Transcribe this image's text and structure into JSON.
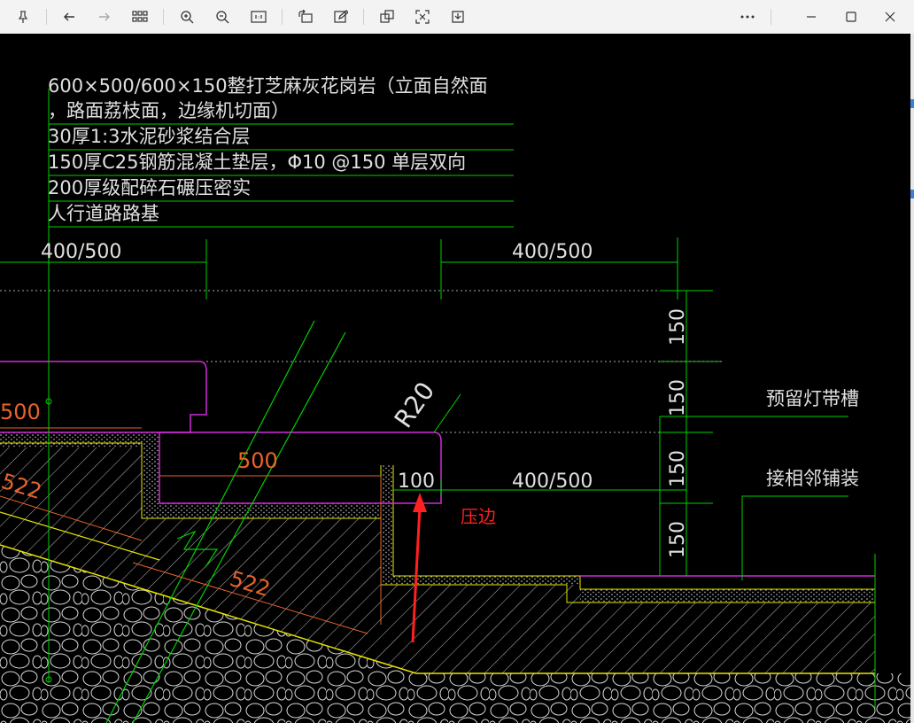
{
  "toolbar": {
    "pin_label": "Pin",
    "back_label": "Back",
    "forward_label": "Forward",
    "grid_label": "Thumbnails",
    "zoom_in_label": "Zoom in",
    "zoom_out_label": "Zoom out",
    "fit_label": "Actual size",
    "rotate_label": "Rotate",
    "edit_label": "Edit",
    "copy_label": "Copy",
    "select_label": "Select",
    "save_label": "Save",
    "more_label": "More",
    "minimize_label": "Minimize",
    "maximize_label": "Maximize",
    "close_label": "Close"
  },
  "drawing": {
    "notes": [
      "600×500/600×150整打芝麻灰花岗岩（立面自然面",
      "，路面荔枝面，边缘机切面）",
      "30厚1:3水泥砂浆结合层",
      "150厚C25钢筋混凝土垫层，Φ10 @150 单层双向",
      "200厚级配碎石碾压密实",
      "人行道路路基"
    ],
    "dims": {
      "top_left": "400/500",
      "top_right": "400/500",
      "mid_right": "400/500",
      "d100": "100",
      "r20": "R20",
      "d500_left": "500",
      "d500_mid": "500",
      "d522_left": "522",
      "d522_bottom": "522",
      "v150_1": "150",
      "v150_2": "150",
      "v150_3": "150",
      "v150_4": "150"
    },
    "labels": {
      "light_groove": "预留灯带槽",
      "adjacent": "接相邻铺装",
      "press_edge": "压边"
    },
    "colors": {
      "canvas": "#000000",
      "green": "#00d000",
      "magenta": "#d12bd8",
      "orange": "#e8632a",
      "yellow": "#e6e600",
      "red": "#ff2020",
      "white": "#e0e0e0"
    }
  }
}
